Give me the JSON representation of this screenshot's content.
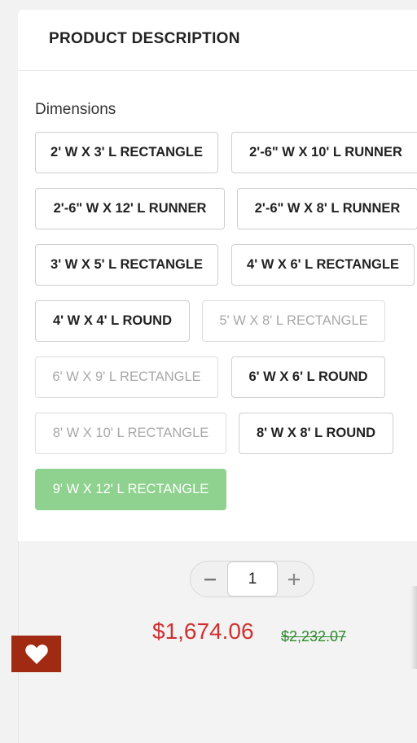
{
  "header": {
    "title": "PRODUCT DESCRIPTION"
  },
  "dimensions": {
    "label": "Dimensions",
    "options": [
      {
        "label": "2' W X 3' L RECTANGLE",
        "state": "available"
      },
      {
        "label": "2'-6\" W X 10' L RUNNER",
        "state": "available"
      },
      {
        "label": "2'-6\" W X 12' L RUNNER",
        "state": "available"
      },
      {
        "label": "2'-6\" W X 8' L RUNNER",
        "state": "available"
      },
      {
        "label": "3' W X 5' L RECTANGLE",
        "state": "available"
      },
      {
        "label": "4' W X 6' L RECTANGLE",
        "state": "available"
      },
      {
        "label": "4' W X 4' L ROUND",
        "state": "available"
      },
      {
        "label": "5' W X 8' L RECTANGLE",
        "state": "disabled"
      },
      {
        "label": "6' W X 9' L RECTANGLE",
        "state": "disabled"
      },
      {
        "label": "6' W X 6' L ROUND",
        "state": "available"
      },
      {
        "label": "8' W X 10' L RECTANGLE",
        "state": "disabled"
      },
      {
        "label": "8' W X 8' L ROUND",
        "state": "available"
      },
      {
        "label": "9' W X 12' L RECTANGLE",
        "state": "selected"
      }
    ]
  },
  "quantity": {
    "minus": "−",
    "plus": "+",
    "value": "1"
  },
  "price": {
    "current": "$1,674.06",
    "original": "$2,232.07"
  },
  "colors": {
    "price_red": "#d03030",
    "original_green": "#2f8a2f",
    "selected_green": "#8fd28f",
    "wishlist_bg": "#a12a12"
  },
  "icons": {
    "wishlist": "heart-icon",
    "decrease": "minus-icon",
    "increase": "plus-icon"
  }
}
